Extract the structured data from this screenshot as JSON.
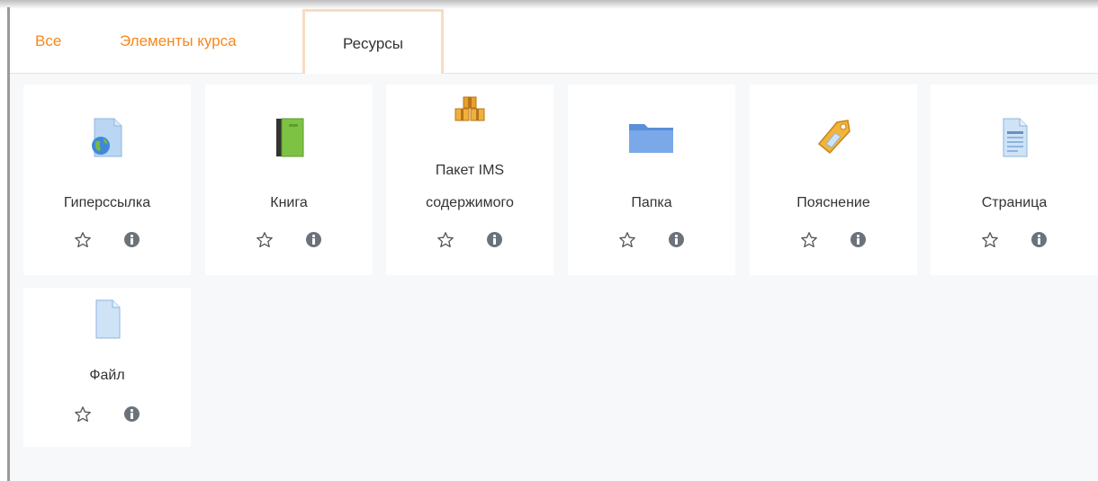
{
  "tabs": [
    {
      "label": "Все",
      "active": false
    },
    {
      "label": "Элементы курса",
      "active": false
    },
    {
      "label": "Ресурсы",
      "active": true
    }
  ],
  "resources": [
    {
      "label": "Гиперссылка",
      "icon": "url-globe-icon"
    },
    {
      "label": "Книга",
      "icon": "book-icon"
    },
    {
      "label_line1": "Пакет IMS",
      "label_line2": "содержимого",
      "icon": "ims-package-icon"
    },
    {
      "label": "Папка",
      "icon": "folder-icon"
    },
    {
      "label": "Пояснение",
      "icon": "label-tag-icon"
    },
    {
      "label": "Страница",
      "icon": "page-icon"
    },
    {
      "label": "Файл",
      "icon": "file-icon"
    }
  ],
  "colors": {
    "tab_link": "#f7871a",
    "active_tab_border": "#f7dcc3",
    "content_bg": "#f7f8f9",
    "card_bg": "#ffffff"
  }
}
